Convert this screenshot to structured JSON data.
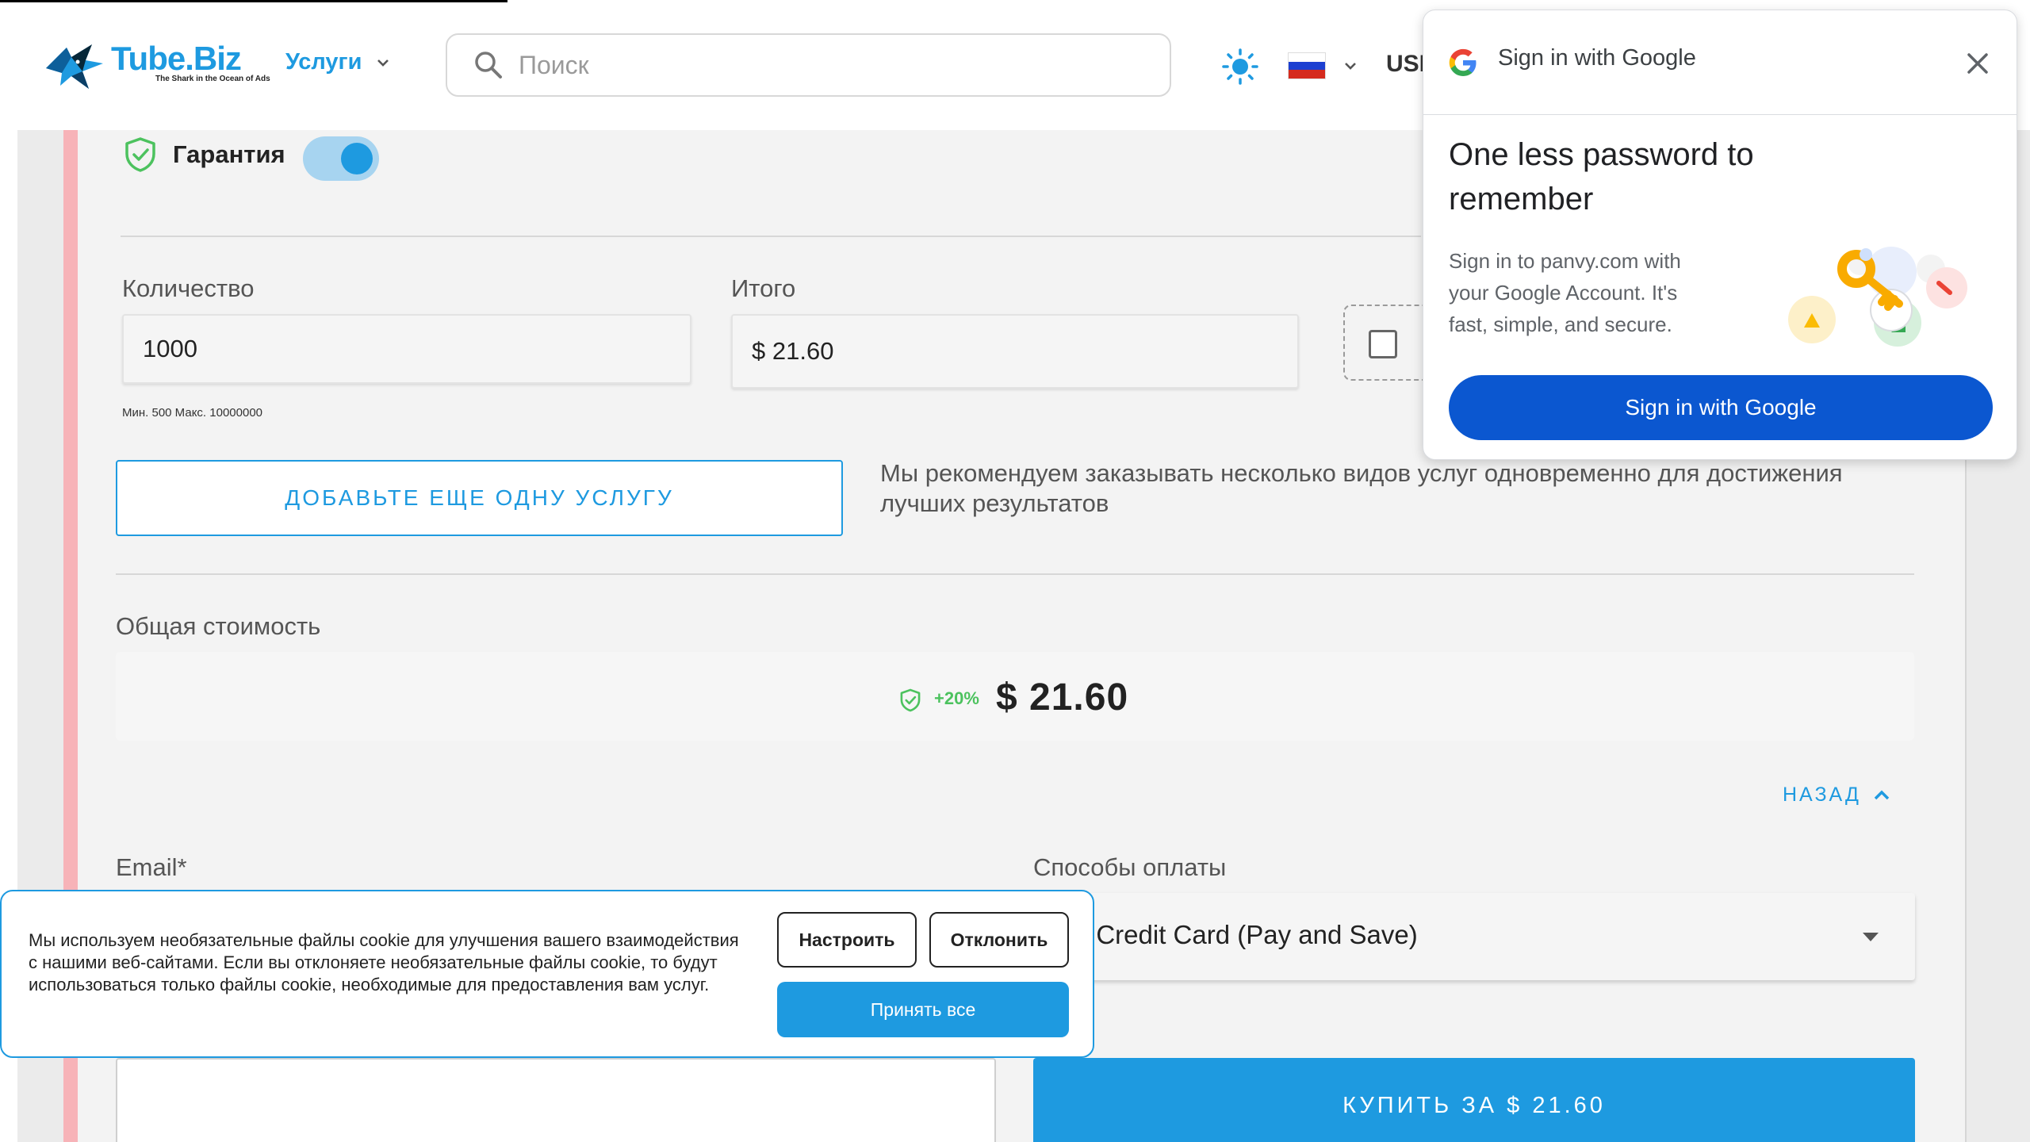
{
  "header": {
    "logo_title": "Tube.Biz",
    "logo_tagline": "The Shark in the Ocean of Ads",
    "services_label": "Услуги",
    "search_placeholder": "Поиск",
    "currency_label": "USI",
    "theme_icon": "sun-icon",
    "language_flag": "russia-flag-icon",
    "flag_colors": [
      "#ffffff",
      "#1c3fd1",
      "#d52b1e"
    ]
  },
  "order": {
    "guarantee_label": "Гарантия",
    "guarantee_enabled": true,
    "quantity_label": "Количество",
    "quantity_value": "1000",
    "minmax_text": "Мин. 500 Макс. 10000000",
    "total_label": "Итого",
    "total_value": "$ 21.60",
    "add_service_label": "ДОБАВЬТЕ ЕЩЕ ОДНУ УСЛУГУ",
    "recommend_text": "Мы рекомендуем заказывать несколько видов услуг одновременно для достижения лучших результатов",
    "overall_label": "Общая стоимость",
    "overall_percent": "+20%",
    "overall_price": "$ 21.60",
    "back_label": "НАЗАД",
    "email_label": "Email*",
    "payment_label": "Способы оплаты",
    "payment_value": "ew Credit Card (Pay and Save)",
    "buy_label": "КУПИТЬ ЗА $ 21.60"
  },
  "cookie": {
    "text": "Мы используем необязательные файлы cookie для улучшения вашего взаимодействия с нашими веб-сайтами. Если вы отклоняете необязательные файлы cookie, то будут использоваться только файлы cookie, необходимые для предоставления вам услуг.",
    "customize_label": "Настроить",
    "decline_label": "Отклонить",
    "accept_label": "Принять все"
  },
  "google_popup": {
    "title": "Sign in with Google",
    "heading": "One less password to remember",
    "description": "Sign in to panvy.com with your Google Account. It's fast, simple, and secure.",
    "button_label": "Sign in with Google"
  },
  "colors": {
    "accent": "#1e9ae0",
    "google_blue": "#0b57d0",
    "guarantee_green": "#4cc25e",
    "pink_strip": "#f7b3b8"
  }
}
